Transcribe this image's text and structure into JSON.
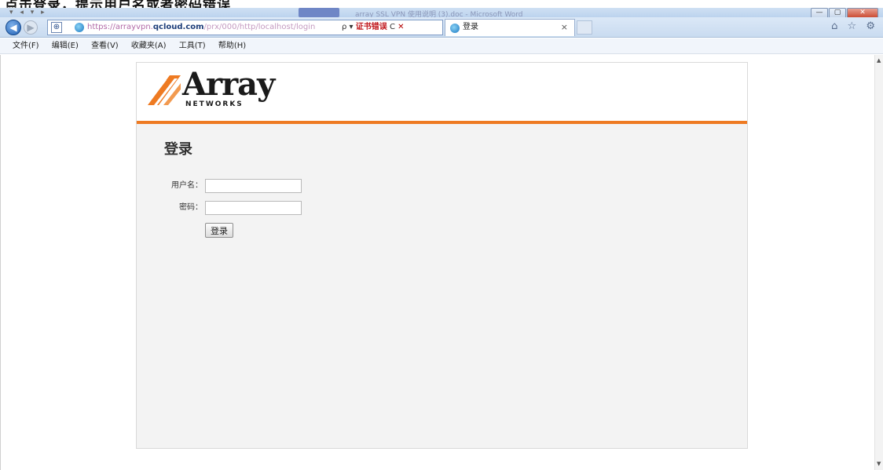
{
  "caption": "点击登录，提示用户名或者密码错误",
  "window": {
    "title": "array SSL VPN 使用说明 (3).doc - Microsoft Word",
    "quick_access": "▾ ◂ ▾ ▸",
    "min": "—",
    "max": "▢",
    "close": "✕"
  },
  "nav": {
    "back": "◀",
    "forward": "▶",
    "compat": "⊕",
    "url_prefix": "https://arrayvpn.",
    "url_domain": "qcloud.com",
    "url_rest": "/prx/000/http/localhost/login",
    "search_icon": "ρ",
    "cert_error": "证书错误",
    "refresh": "C",
    "stop": "✕",
    "tab_title": "登录",
    "tab_close": "×",
    "right_icons": "⌂ ☆ ⚙"
  },
  "menu": [
    "文件(F)",
    "编辑(E)",
    "查看(V)",
    "收藏夹(A)",
    "工具(T)",
    "帮助(H)"
  ],
  "page": {
    "logo_word": "Array",
    "logo_sub": "NETWORKS",
    "title": "登录",
    "username_label": "用户名：",
    "password_label": "密码：",
    "login_button": "登录",
    "username_value": "",
    "password_value": ""
  },
  "colors": {
    "accent": "#ee7a22",
    "panel_bg": "#f3f3f3"
  }
}
